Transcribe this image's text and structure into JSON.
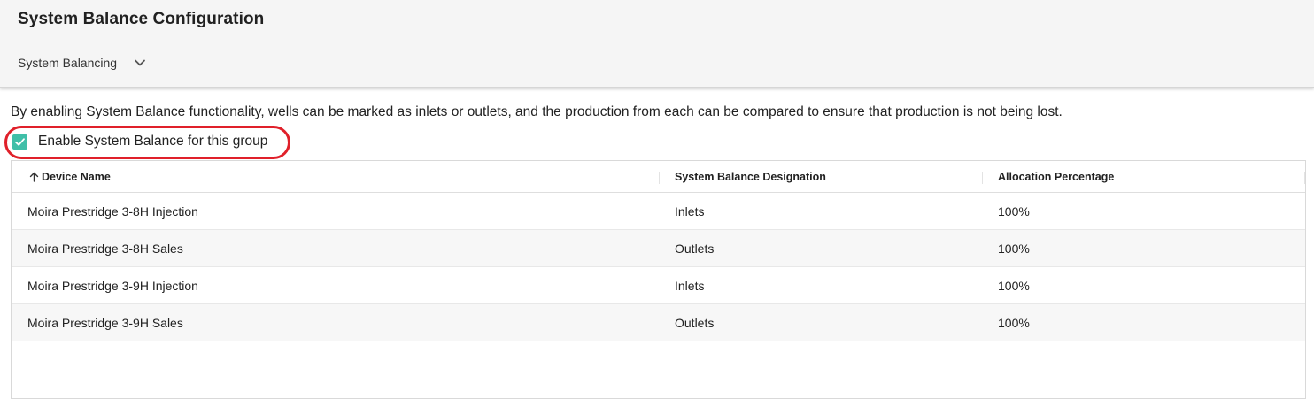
{
  "header": {
    "title": "System Balance Configuration",
    "subnav": {
      "label": "System Balancing",
      "icon": "chevron-down-icon"
    }
  },
  "description": "By enabling System Balance functionality, wells can be marked as inlets or outlets, and the production from each can be compared to ensure that production is not being lost.",
  "enable_option": {
    "label": "Enable System Balance for this group",
    "checked": true,
    "checkbox_color": "#3fbfa8",
    "highlight_color": "#e0202a"
  },
  "table": {
    "columns": [
      "Device Name",
      "System Balance Designation",
      "Allocation Percentage"
    ],
    "sort": {
      "column": "Device Name",
      "direction": "ascending",
      "icon": "arrow-up-icon"
    },
    "rows": [
      [
        "Moira Prestridge 3-8H Injection",
        "Inlets",
        "100%"
      ],
      [
        "Moira Prestridge 3-8H Sales",
        "Outlets",
        "100%"
      ],
      [
        "Moira Prestridge 3-9H Injection",
        "Inlets",
        "100%"
      ],
      [
        "Moira Prestridge 3-9H Sales",
        "Outlets",
        "100%"
      ]
    ]
  }
}
